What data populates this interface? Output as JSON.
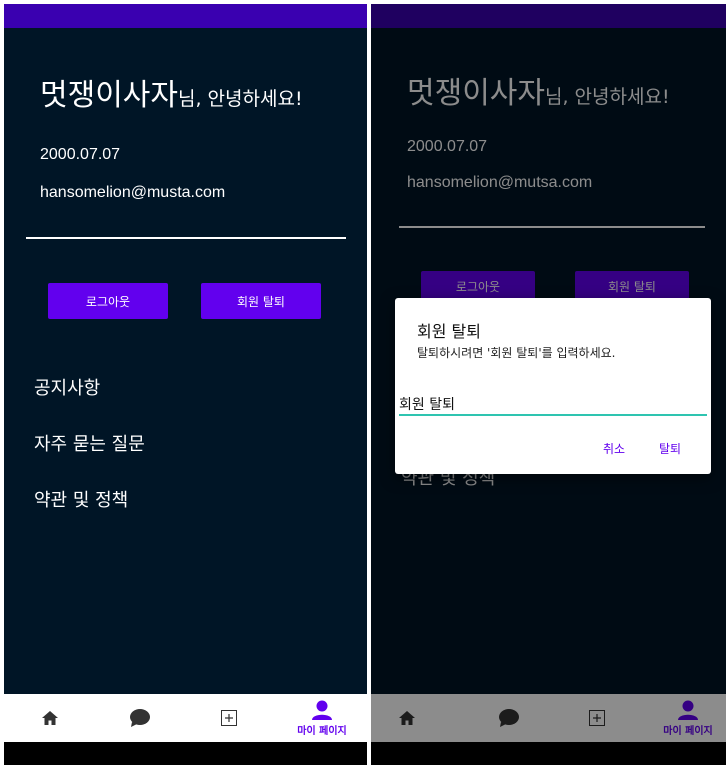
{
  "left": {
    "greeting": {
      "name": "멋쟁이사자",
      "suffix": "님, 안녕하세요!"
    },
    "birthdate": "2000.07.07",
    "email": "hansomelion@musta.com",
    "buttons": {
      "logout": "로그아웃",
      "withdraw": "회원 탈퇴"
    },
    "menu": [
      "공지사항",
      "자주 묻는 질문",
      "약관 및 정책"
    ],
    "nav": {
      "profile_label": "마이 페이지"
    }
  },
  "right": {
    "greeting": {
      "name": "멋쟁이사자",
      "suffix": "님, 안녕하세요!"
    },
    "birthdate": "2000.07.07",
    "email": "hansomelion@mutsa.com",
    "buttons": {
      "logout": "로그아웃",
      "withdraw": "회원 탈퇴"
    },
    "menu_partial": "약관 및 정책",
    "nav": {
      "profile_label": "마이 페이지"
    },
    "dialog": {
      "title": "회원 탈퇴",
      "message": "탈퇴하시려면 '회원 탈퇴'를 입력하세요.",
      "input_value": "회원 탈퇴",
      "cancel": "취소",
      "confirm": "탈퇴"
    }
  },
  "icons": [
    "home-icon",
    "chat-icon",
    "add-box-icon",
    "person-icon"
  ],
  "colors": {
    "status_bar": "#3a00b0",
    "background": "#001526",
    "primary": "#6200ee",
    "input_accent": "#2ec4b0"
  }
}
